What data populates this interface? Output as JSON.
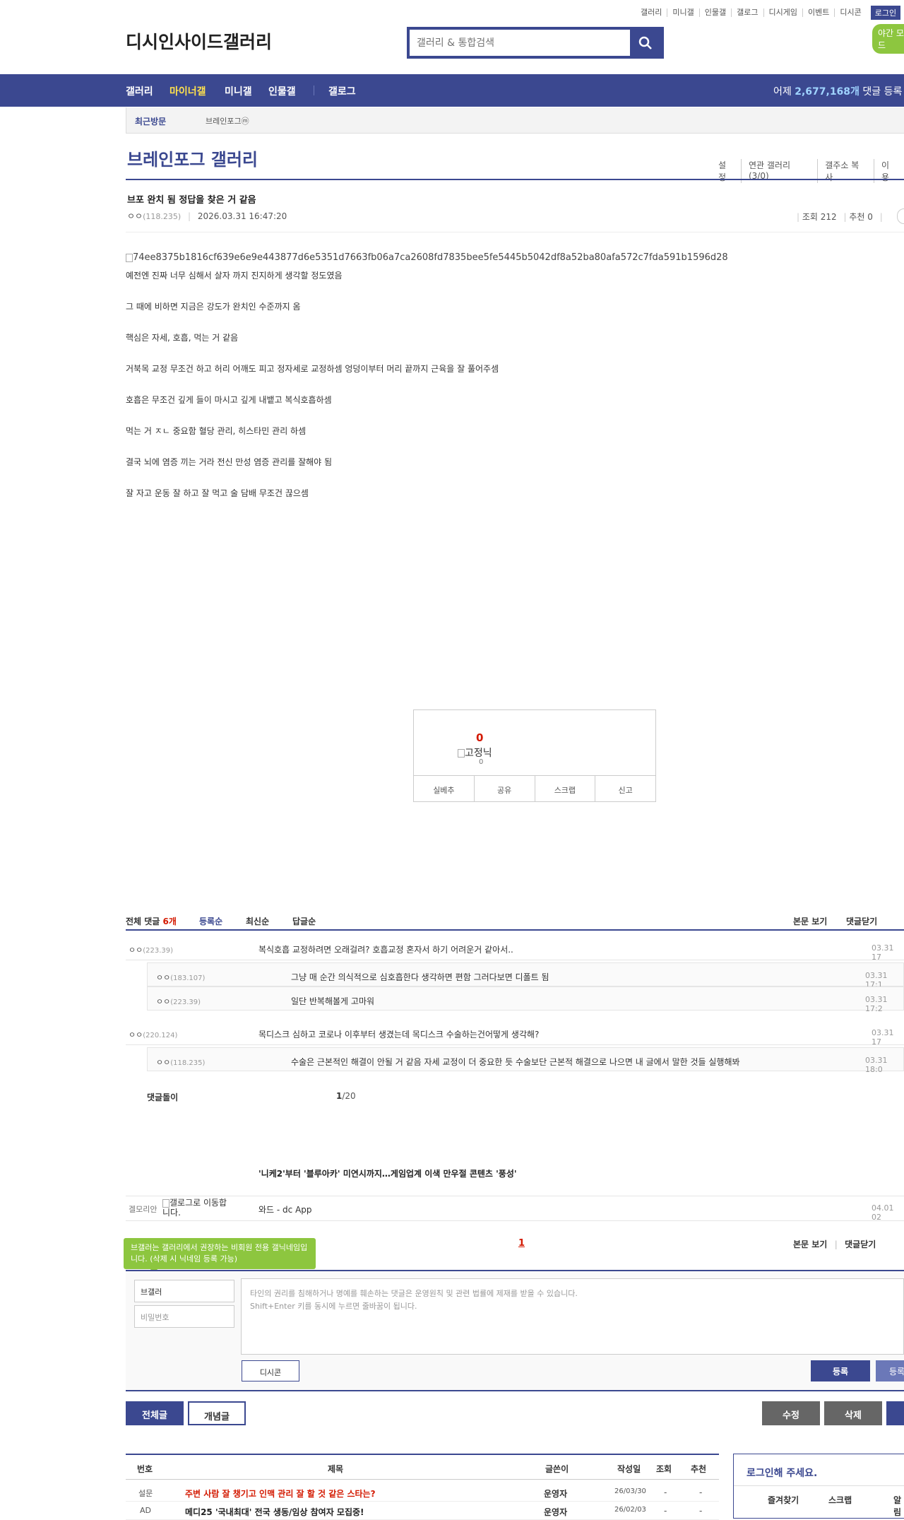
{
  "top_util": {
    "links": [
      "갤러리",
      "미니갤",
      "인물갤",
      "갤로그",
      "디시게임",
      "이벤트",
      "디시콘"
    ],
    "login": "로그인",
    "night": "야간 모드"
  },
  "logo": "디시인사이드갤러리",
  "search": {
    "placeholder": "갤러리 & 통합검색"
  },
  "gnb": {
    "items": [
      "갤러리",
      "마이너갤",
      "미니갤",
      "인물갤",
      "갤로그"
    ],
    "stat_prefix": "어제",
    "stat_count": "2,677,168개",
    "stat_suffix": "댓글 등록"
  },
  "recent": {
    "label": "최근방문",
    "gallery": "브레인포그ⓜ"
  },
  "gallery": {
    "title": "브레인포그 갤러리",
    "links": [
      "설정",
      "연관 갤러리(3/0)",
      "갤주소 복사",
      "이용"
    ]
  },
  "post": {
    "title": "브포 완치 됨 정답을 찾은 거 같음",
    "nick": "ㅇㅇ",
    "ip": "(118.235)",
    "date": "2026.03.31 16:47:20",
    "views": "조회 212",
    "recommend": "추천 0",
    "image_alt": "74ee8375b1816cf639e6e9e443877d6e5351d7663fb06a7ca2608fd7835bee5fe5445b5042df8a52ba80afa572c7fda591b1596d28",
    "lines": [
      "예전엔 진짜 너무 심해서 살자 까지 진지하게 생각할 정도였음",
      "그 때에 비하면 지금은 강도가 완치인 수준까지 옴",
      "핵심은 자세, 호흡, 먹는 거 같음",
      "거북목 교정 무조건 하고 허리 어깨도 피고 정자세로 교정하셈 엉덩이부터 머리 끝까지 근육을 잘 풀어주셈",
      "호흡은 무조건 깊게 들이 마시고 깊게 내뱉고 복식호흡하셈",
      "먹는 거 ㅈㄴ 중요함 혈당 관리, 히스타민 관리 하셈",
      "결국 뇌에 염증 끼는 거라 전신 만성 염증 관리를 잘해야 됨",
      "잘 자고 운동 잘 하고 잘 먹고 술 담배 무조건 끊으셈"
    ]
  },
  "recommend_box": {
    "count": "0",
    "fixed_nick_alt": "고정닉",
    "fixed_count": "0",
    "buttons": [
      "실베추",
      "공유",
      "스크랩",
      "신고"
    ]
  },
  "comments": {
    "total_label": "전체 댓글",
    "total_count": "6개",
    "sort": [
      "등록순",
      "최신순",
      "답글순"
    ],
    "right_links": [
      "본문 보기",
      "댓글닫기"
    ],
    "items": [
      {
        "nick": "ㅇㅇ",
        "ip": "(223.39)",
        "text": "복식호흡 교정하려면 오래걸려? 호흡교정 혼자서 하기 어려운거 같아서..",
        "date": "03.31 17"
      },
      {
        "nick": "ㅇㅇ",
        "ip": "(183.107)",
        "text": "그냥 매 순간 의식적으로 심호흡한다 생각하면 편함 그러다보면 디폴트 됨",
        "date": "03.31 17:1"
      },
      {
        "nick": "ㅇㅇ",
        "ip": "(223.39)",
        "text": "일단 반복해볼게 고마워",
        "date": "03.31 17:2"
      },
      {
        "nick": "ㅇㅇ",
        "ip": "(220.124)",
        "text": "목디스크 심하고 코로나 이후부터 생겼는데 목디스크 수술하는건어떻게 생각해?",
        "date": "03.31 17"
      },
      {
        "nick": "ㅇㅇ",
        "ip": "(118.235)",
        "text": "수술은 근본적인 해결이 안될 거 같음 자세 교정이 더 중요한 듯 수술보단 근본적 해결으로 나으면 내 글에서 말한 것들 실행해봐",
        "date": "03.31 18:0"
      }
    ],
    "dory_label": "댓글돌이",
    "page": "1",
    "page_total": "/20",
    "news": "'니케2'부터 '블루아카' 미연시까지…게임업계 이색 만우절 콘텐츠 '풍성'",
    "dory": {
      "nick": "겔모리안",
      "icon_alt": "갤로그로 이동합니다.",
      "text": "와드 - dc App",
      "date": "04.01 02"
    },
    "page2": "1"
  },
  "write": {
    "tip": "브갤러는 갤러리에서 권장하는 비회원 전용 갤닉네임입니다. (삭제 시 닉네임 등록 가능)",
    "nick_value": "브갤러",
    "pw_placeholder": "비밀번호",
    "textarea_line1": "타인의 권리를 침해하거나 명예를 훼손하는 댓글은 운영원칙 및 관련 법률에 제재를 받을 수 있습니다.",
    "textarea_line2": "Shift+Enter 키를 동시에 누르면 줄바꿈이 됩니다.",
    "dccon": "디시콘",
    "register": "등록",
    "register2": "등록"
  },
  "bottom_buttons": {
    "all": "전체글",
    "concept": "개념글",
    "edit": "수정",
    "delete": "삭제"
  },
  "list": {
    "headers": [
      "번호",
      "제목",
      "글쓴이",
      "작성일",
      "조회",
      "추천"
    ],
    "rows": [
      {
        "num": "설문",
        "title": "주변 사람 잘 챙기고 인맥 관리 잘 할 것 같은 스타는?",
        "writer": "운영자",
        "date": "26/03/30",
        "views": "-",
        "rec": "-"
      },
      {
        "num": "AD",
        "title": "메디25 '국내최대' 전국 생동/임상 참여자 모집중!",
        "writer": "운영자",
        "date": "26/02/03",
        "views": "-",
        "rec": "-"
      }
    ]
  },
  "login_box": {
    "title": "로그인해 주세요.",
    "buttons": [
      "즐겨찾기",
      "스크랩",
      "알림"
    ]
  },
  "colors": {
    "brand": "#3b4890",
    "accent_red": "#d31900",
    "green": "#8dc63f"
  }
}
